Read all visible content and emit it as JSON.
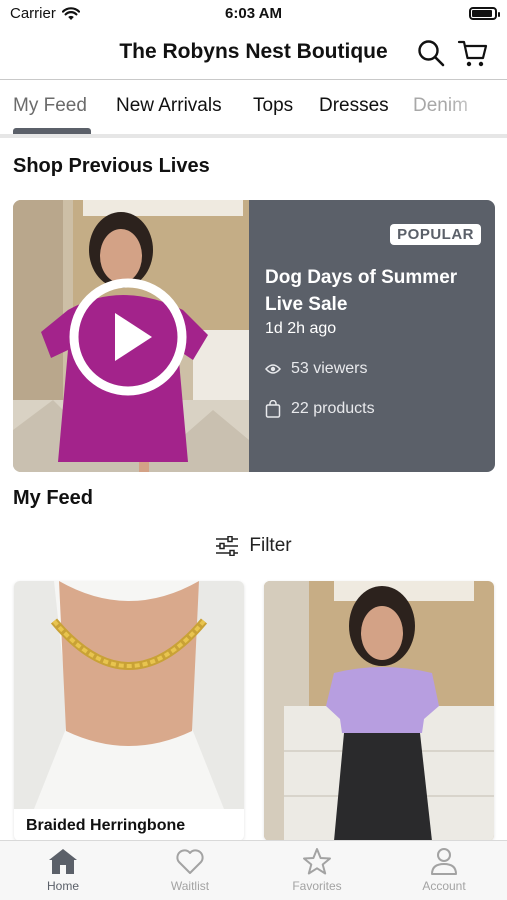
{
  "status_bar": {
    "carrier": "Carrier",
    "time": "6:03 AM",
    "battery_level": 0.9
  },
  "header": {
    "title": "The Robyns Nest Boutique",
    "search_icon": "search-icon",
    "cart_icon": "cart-icon"
  },
  "tabs": [
    {
      "label": "My Feed",
      "active": true
    },
    {
      "label": "New Arrivals"
    },
    {
      "label": "Tops"
    },
    {
      "label": "Dresses"
    },
    {
      "label": "Denim"
    }
  ],
  "previous_lives": {
    "section_title": "Shop Previous Lives",
    "card": {
      "badge": "POPULAR",
      "title": "Dog Days of Summer Live Sale",
      "time_ago": "1d 2h ago",
      "viewers": "53 viewers",
      "products": "22 products",
      "play_icon": "play-icon"
    }
  },
  "feed": {
    "section_title": "My Feed",
    "filter_label": "Filter",
    "products": [
      {
        "name": "Braided Herringbone"
      },
      {
        "name": ""
      }
    ]
  },
  "tabbar": [
    {
      "label": "Home",
      "icon": "home-icon",
      "active": true
    },
    {
      "label": "Waitlist",
      "icon": "heart-icon"
    },
    {
      "label": "Favorites",
      "icon": "star-icon"
    },
    {
      "label": "Account",
      "icon": "person-icon"
    }
  ],
  "colors": {
    "accent": "#5b6069",
    "inactive": "#a3a3a3"
  }
}
